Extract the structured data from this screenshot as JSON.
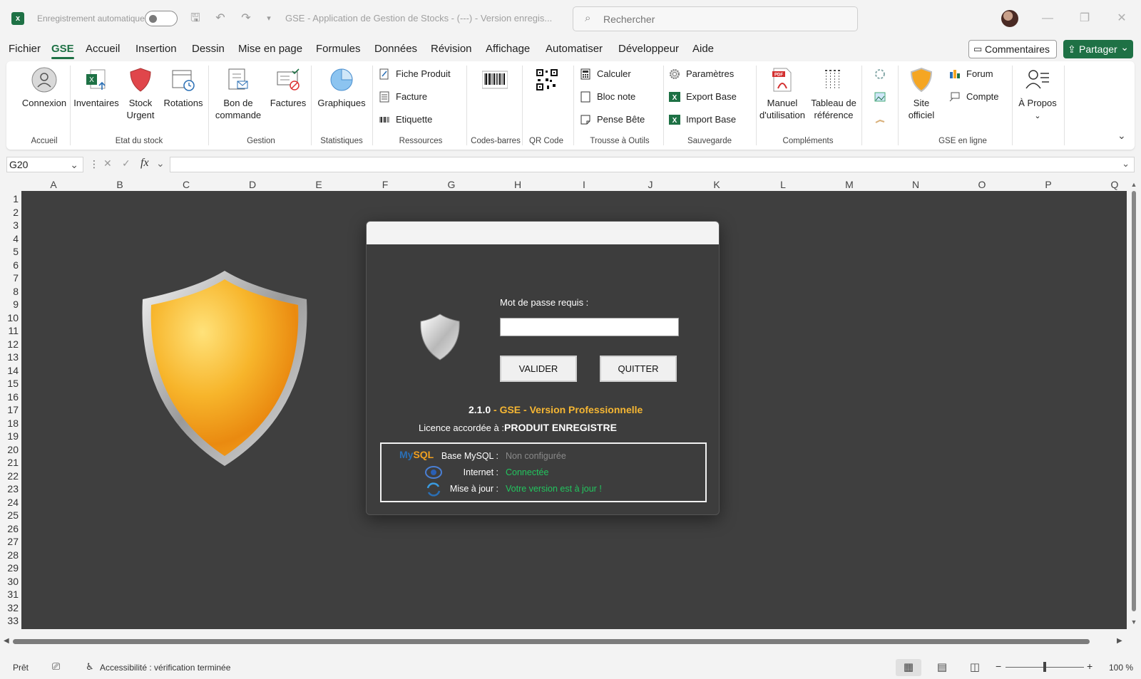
{
  "titlebar": {
    "autosave_label": "Enregistrement automatique",
    "doc_title": "GSE - Application de Gestion de Stocks - (---) - Version enregis...",
    "search_placeholder": "Rechercher"
  },
  "menu": {
    "tabs": [
      "Fichier",
      "GSE",
      "Accueil",
      "Insertion",
      "Dessin",
      "Mise en page",
      "Formules",
      "Données",
      "Révision",
      "Affichage",
      "Automatiser",
      "Développeur",
      "Aide"
    ],
    "active_tab": "GSE",
    "comments_label": "Commentaires",
    "share_label": "Partager"
  },
  "ribbon": {
    "accueil": {
      "button": "Connexion",
      "group": "Accueil"
    },
    "etat": {
      "inventaires": "Inventaires",
      "stock_urgent_1": "Stock",
      "stock_urgent_2": "Urgent",
      "rotations": "Rotations",
      "group": "Etat du stock"
    },
    "gestion": {
      "bon_1": "Bon de",
      "bon_2": "commande",
      "factures": "Factures",
      "group": "Gestion"
    },
    "stats": {
      "graphiques": "Graphiques",
      "group": "Statistiques"
    },
    "ressources": {
      "fiche": "Fiche Produit",
      "facture": "Facture",
      "etiquette": "Etiquette",
      "group": "Ressources"
    },
    "codes": {
      "group": "Codes-barres"
    },
    "qr": {
      "group": "QR Code"
    },
    "trousse": {
      "calculer": "Calculer",
      "bloc": "Bloc note",
      "pense": "Pense Bête",
      "group": "Trousse à Outils"
    },
    "sauvegarde": {
      "parametres": "Paramètres",
      "export": "Export Base",
      "import": "Import Base",
      "group": "Sauvegarde"
    },
    "complements": {
      "manuel_1": "Manuel",
      "manuel_2": "d'utilisation",
      "tableau_1": "Tableau de",
      "tableau_2": "référence",
      "group": "Compléments"
    },
    "enligne": {
      "site_1": "Site",
      "site_2": "officiel",
      "forum": "Forum",
      "compte": "Compte",
      "apropos": "À Propos",
      "group": "GSE en ligne"
    }
  },
  "formula_bar": {
    "name_box": "G20",
    "fx": "fx",
    "value": ""
  },
  "columns": [
    "A",
    "B",
    "C",
    "D",
    "E",
    "F",
    "G",
    "H",
    "I",
    "J",
    "K",
    "L",
    "M",
    "N",
    "O",
    "P",
    "Q"
  ],
  "rows": [
    "1",
    "2",
    "3",
    "4",
    "5",
    "6",
    "7",
    "8",
    "9",
    "10",
    "11",
    "12",
    "13",
    "14",
    "15",
    "16",
    "17",
    "18",
    "19",
    "20",
    "21",
    "22",
    "23",
    "24",
    "25",
    "26",
    "27",
    "28",
    "29",
    "30",
    "31",
    "32",
    "33"
  ],
  "dialog": {
    "password_label": "Mot de passe requis :",
    "validate": "VALIDER",
    "quit": "QUITTER",
    "version": "2.1.0",
    "product": "- GSE - Version Professionnelle",
    "license_label": "Licence accordée à :",
    "license_value": "PRODUIT ENREGISTRE",
    "mysql_logo_my": "My",
    "mysql_logo_sql": "SQL",
    "status": [
      {
        "label": "Base MySQL :",
        "value": "Non configurée",
        "color": "#8a8a8a"
      },
      {
        "label": "Internet :",
        "value": "Connectée",
        "color": "#22c55e"
      },
      {
        "label": "Mise à jour :",
        "value": "Votre version est à jour !",
        "color": "#22c55e"
      }
    ]
  },
  "statusbar": {
    "ready": "Prêt",
    "accessibility": "Accessibilité : vérification terminée",
    "zoom": "100 %"
  },
  "colors": {
    "accent": "#1e7145",
    "sheet_bg": "#3f3f3f",
    "version_orange": "#f5b633"
  }
}
